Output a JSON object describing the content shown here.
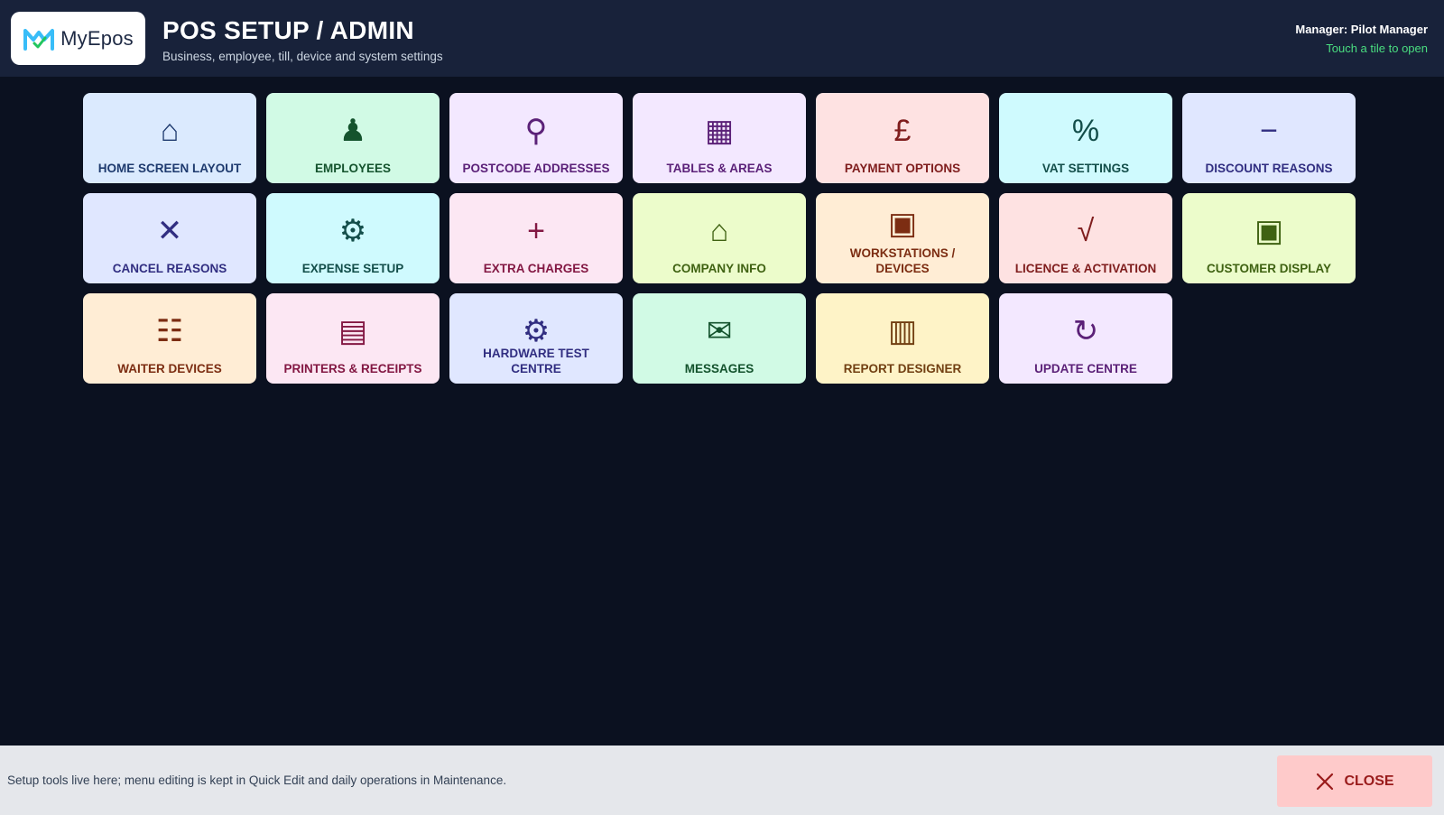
{
  "header": {
    "logo_text": "MyEpos",
    "title": "POS SETUP / ADMIN",
    "subtitle": "Business, employee, till, device and system settings",
    "manager": "Manager: Pilot Manager",
    "hint": "Touch a tile to open"
  },
  "colors": {
    "blue_bg": "#dbeafe",
    "blue_fg": "#1e3a6e",
    "green_bg": "#d1fae5",
    "green_fg": "#14532d",
    "purple_bg": "#f3e8ff",
    "purple_fg": "#5b2178",
    "red_bg": "#fee2e2",
    "red_fg": "#7f1d1d",
    "teal_bg": "#cffafe",
    "teal_fg": "#134e4a",
    "indigo_bg": "#e0e7ff",
    "indigo_fg": "#312e81",
    "pink_bg": "#fce7f3",
    "pink_fg": "#831843",
    "lime_bg": "#ecfccb",
    "lime_fg": "#3f6212",
    "orange_bg": "#ffedd5",
    "orange_fg": "#7c2d12",
    "amber_bg": "#fef3c7",
    "amber_fg": "#713f12"
  },
  "tiles": [
    {
      "label": "HOME SCREEN LAYOUT",
      "icon": "home-icon",
      "glyph": "⌂",
      "color": "blue"
    },
    {
      "label": "EMPLOYEES",
      "icon": "pawn-icon",
      "glyph": "♟",
      "color": "green"
    },
    {
      "label": "POSTCODE ADDRESSES",
      "icon": "magnifier-icon",
      "glyph": "⚲",
      "color": "purple"
    },
    {
      "label": "TABLES & AREAS",
      "icon": "grid-icon",
      "glyph": "▦",
      "color": "purple"
    },
    {
      "label": "PAYMENT OPTIONS",
      "icon": "pound-icon",
      "glyph": "£",
      "color": "red"
    },
    {
      "label": "VAT SETTINGS",
      "icon": "percent-icon",
      "glyph": "%",
      "color": "teal"
    },
    {
      "label": "DISCOUNT REASONS",
      "icon": "minus-icon",
      "glyph": "−",
      "color": "indigo"
    },
    {
      "label": "CANCEL REASONS",
      "icon": "cross-icon",
      "glyph": "✕",
      "color": "indigo"
    },
    {
      "label": "EXPENSE SETUP",
      "icon": "gear-icon",
      "glyph": "⚙",
      "color": "teal"
    },
    {
      "label": "EXTRA CHARGES",
      "icon": "plus-icon",
      "glyph": "+",
      "color": "pink"
    },
    {
      "label": "COMPANY INFO",
      "icon": "home-icon",
      "glyph": "⌂",
      "color": "lime"
    },
    {
      "label": "WORKSTATIONS / DEVICES",
      "icon": "square-icon",
      "glyph": "▣",
      "color": "orange"
    },
    {
      "label": "LICENCE & ACTIVATION",
      "icon": "check-icon",
      "glyph": "√",
      "color": "red"
    },
    {
      "label": "CUSTOMER DISPLAY",
      "icon": "square-icon",
      "glyph": "▣",
      "color": "lime"
    },
    {
      "label": "WAITER DEVICES",
      "icon": "list-icon",
      "glyph": "☷",
      "color": "orange"
    },
    {
      "label": "PRINTERS & RECEIPTS",
      "icon": "receipt-icon",
      "glyph": "▤",
      "color": "pink"
    },
    {
      "label": "HARDWARE TEST CENTRE",
      "icon": "gear-icon",
      "glyph": "⚙",
      "color": "indigo"
    },
    {
      "label": "MESSAGES",
      "icon": "envelope-icon",
      "glyph": "✉",
      "color": "green"
    },
    {
      "label": "REPORT DESIGNER",
      "icon": "columns-icon",
      "glyph": "▥",
      "color": "amber"
    },
    {
      "label": "UPDATE CENTRE",
      "icon": "refresh-icon",
      "glyph": "↻",
      "color": "purple"
    }
  ],
  "footer": {
    "text": "Setup tools live here; menu editing is kept in Quick Edit and daily operations in Maintenance.",
    "close_label": "CLOSE"
  }
}
